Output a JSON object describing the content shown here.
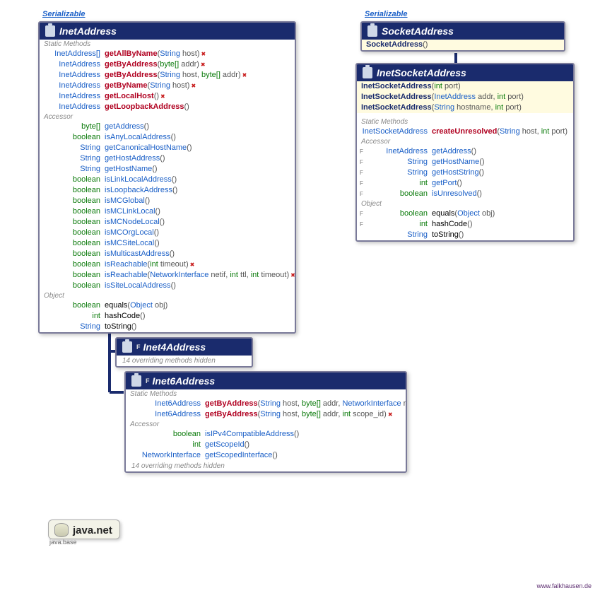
{
  "interfaces": {
    "serial1": "Serializable",
    "serial2": "Serializable"
  },
  "inetAddress": {
    "title": "InetAddress",
    "sections": {
      "static": "Static Methods",
      "accessor": "Accessor",
      "object": "Object"
    },
    "staticRows": [
      {
        "ret": "InetAddress[]",
        "name": "getAllByName",
        "args": [
          [
            "String",
            "host"
          ]
        ],
        "exc": true
      },
      {
        "ret": "InetAddress",
        "name": "getByAddress",
        "args": [
          [
            "byte[]",
            "addr"
          ]
        ],
        "exc": true
      },
      {
        "ret": "InetAddress",
        "name": "getByAddress",
        "args": [
          [
            "String",
            "host"
          ],
          [
            "byte[]",
            "addr"
          ]
        ],
        "exc": true
      },
      {
        "ret": "InetAddress",
        "name": "getByName",
        "args": [
          [
            "String",
            "host"
          ]
        ],
        "exc": true
      },
      {
        "ret": "InetAddress",
        "name": "getLocalHost",
        "args": [],
        "exc": true
      },
      {
        "ret": "InetAddress",
        "name": "getLoopbackAddress",
        "args": [],
        "exc": false
      }
    ],
    "accessorRows": [
      {
        "ret": "byte[]",
        "retGreen": true,
        "name": "getAddress",
        "blue": true,
        "args": []
      },
      {
        "ret": "boolean",
        "retGreen": true,
        "name": "isAnyLocalAddress",
        "blue": true,
        "args": []
      },
      {
        "ret": "String",
        "name": "getCanonicalHostName",
        "blue": true,
        "args": []
      },
      {
        "ret": "String",
        "name": "getHostAddress",
        "blue": true,
        "args": []
      },
      {
        "ret": "String",
        "name": "getHostName",
        "blue": true,
        "args": []
      },
      {
        "ret": "boolean",
        "retGreen": true,
        "name": "isLinkLocalAddress",
        "blue": true,
        "args": []
      },
      {
        "ret": "boolean",
        "retGreen": true,
        "name": "isLoopbackAddress",
        "blue": true,
        "args": []
      },
      {
        "ret": "boolean",
        "retGreen": true,
        "name": "isMCGlobal",
        "blue": true,
        "args": []
      },
      {
        "ret": "boolean",
        "retGreen": true,
        "name": "isMCLinkLocal",
        "blue": true,
        "args": []
      },
      {
        "ret": "boolean",
        "retGreen": true,
        "name": "isMCNodeLocal",
        "blue": true,
        "args": []
      },
      {
        "ret": "boolean",
        "retGreen": true,
        "name": "isMCOrgLocal",
        "blue": true,
        "args": []
      },
      {
        "ret": "boolean",
        "retGreen": true,
        "name": "isMCSiteLocal",
        "blue": true,
        "args": []
      },
      {
        "ret": "boolean",
        "retGreen": true,
        "name": "isMulticastAddress",
        "blue": true,
        "args": []
      },
      {
        "ret": "boolean",
        "retGreen": true,
        "name": "isReachable",
        "blue": true,
        "args": [
          [
            "int",
            "timeout"
          ]
        ],
        "exc": true
      },
      {
        "ret": "boolean",
        "retGreen": true,
        "name": "isReachable",
        "blue": true,
        "args": [
          [
            "NetworkInterface",
            "netif"
          ],
          [
            "int",
            "ttl"
          ],
          [
            "int",
            "timeout"
          ]
        ],
        "exc": true
      },
      {
        "ret": "boolean",
        "retGreen": true,
        "name": "isSiteLocalAddress",
        "blue": true,
        "args": []
      }
    ],
    "objectRows": [
      {
        "ret": "boolean",
        "retGreen": true,
        "name": "equals",
        "args": [
          [
            "Object",
            "obj"
          ]
        ]
      },
      {
        "ret": "int",
        "retGreen": true,
        "name": "hashCode",
        "args": []
      },
      {
        "ret": "String",
        "name": "toString",
        "args": []
      }
    ]
  },
  "inet4": {
    "title": "Inet4Address",
    "note": "14 overriding methods hidden",
    "final": "F"
  },
  "inet6": {
    "title": "Inet6Address",
    "final": "F",
    "sections": {
      "static": "Static Methods",
      "accessor": "Accessor"
    },
    "staticRows": [
      {
        "ret": "Inet6Address",
        "name": "getByAddress",
        "args": [
          [
            "String",
            "host"
          ],
          [
            "byte[]",
            "addr"
          ],
          [
            "NetworkInterface",
            "nif"
          ]
        ],
        "exc": true
      },
      {
        "ret": "Inet6Address",
        "name": "getByAddress",
        "args": [
          [
            "String",
            "host"
          ],
          [
            "byte[]",
            "addr"
          ],
          [
            "int",
            "scope_id"
          ]
        ],
        "exc": true
      }
    ],
    "accessorRows": [
      {
        "ret": "boolean",
        "retGreen": true,
        "name": "isIPv4CompatibleAddress",
        "blue": true,
        "args": []
      },
      {
        "ret": "int",
        "retGreen": true,
        "name": "getScopeId",
        "blue": true,
        "args": []
      },
      {
        "ret": "NetworkInterface",
        "name": "getScopedInterface",
        "blue": true,
        "args": []
      }
    ],
    "note": "14 overriding methods hidden"
  },
  "socketAddress": {
    "title": "SocketAddress",
    "ctor": {
      "name": "SocketAddress",
      "args": []
    }
  },
  "inetSocketAddress": {
    "title": "InetSocketAddress",
    "ctors": [
      {
        "name": "InetSocketAddress",
        "args": [
          [
            "int",
            "port"
          ]
        ]
      },
      {
        "name": "InetSocketAddress",
        "args": [
          [
            "InetAddress",
            "addr"
          ],
          [
            "int",
            "port"
          ]
        ]
      },
      {
        "name": "InetSocketAddress",
        "args": [
          [
            "String",
            "hostname"
          ],
          [
            "int",
            "port"
          ]
        ]
      }
    ],
    "sections": {
      "static": "Static Methods",
      "accessor": "Accessor",
      "object": "Object"
    },
    "staticRows": [
      {
        "ret": "InetSocketAddress",
        "name": "createUnresolved",
        "args": [
          [
            "String",
            "host"
          ],
          [
            "int",
            "port"
          ]
        ]
      }
    ],
    "accessorRows": [
      {
        "ret": "InetAddress",
        "name": "getAddress",
        "blue": true,
        "final": true,
        "args": []
      },
      {
        "ret": "String",
        "name": "getHostName",
        "blue": true,
        "final": true,
        "args": []
      },
      {
        "ret": "String",
        "name": "getHostString",
        "blue": true,
        "final": true,
        "args": []
      },
      {
        "ret": "int",
        "retGreen": true,
        "name": "getPort",
        "blue": true,
        "final": true,
        "args": []
      },
      {
        "ret": "boolean",
        "retGreen": true,
        "name": "isUnresolved",
        "blue": true,
        "final": true,
        "args": []
      }
    ],
    "objectRows": [
      {
        "ret": "boolean",
        "retGreen": true,
        "name": "equals",
        "final": true,
        "args": [
          [
            "Object",
            "obj"
          ]
        ]
      },
      {
        "ret": "int",
        "retGreen": true,
        "name": "hashCode",
        "final": true,
        "args": []
      },
      {
        "ret": "String",
        "name": "toString",
        "args": []
      }
    ]
  },
  "package": {
    "name": "java.net",
    "module": "java.base"
  },
  "footer": "www.falkhausen.de"
}
